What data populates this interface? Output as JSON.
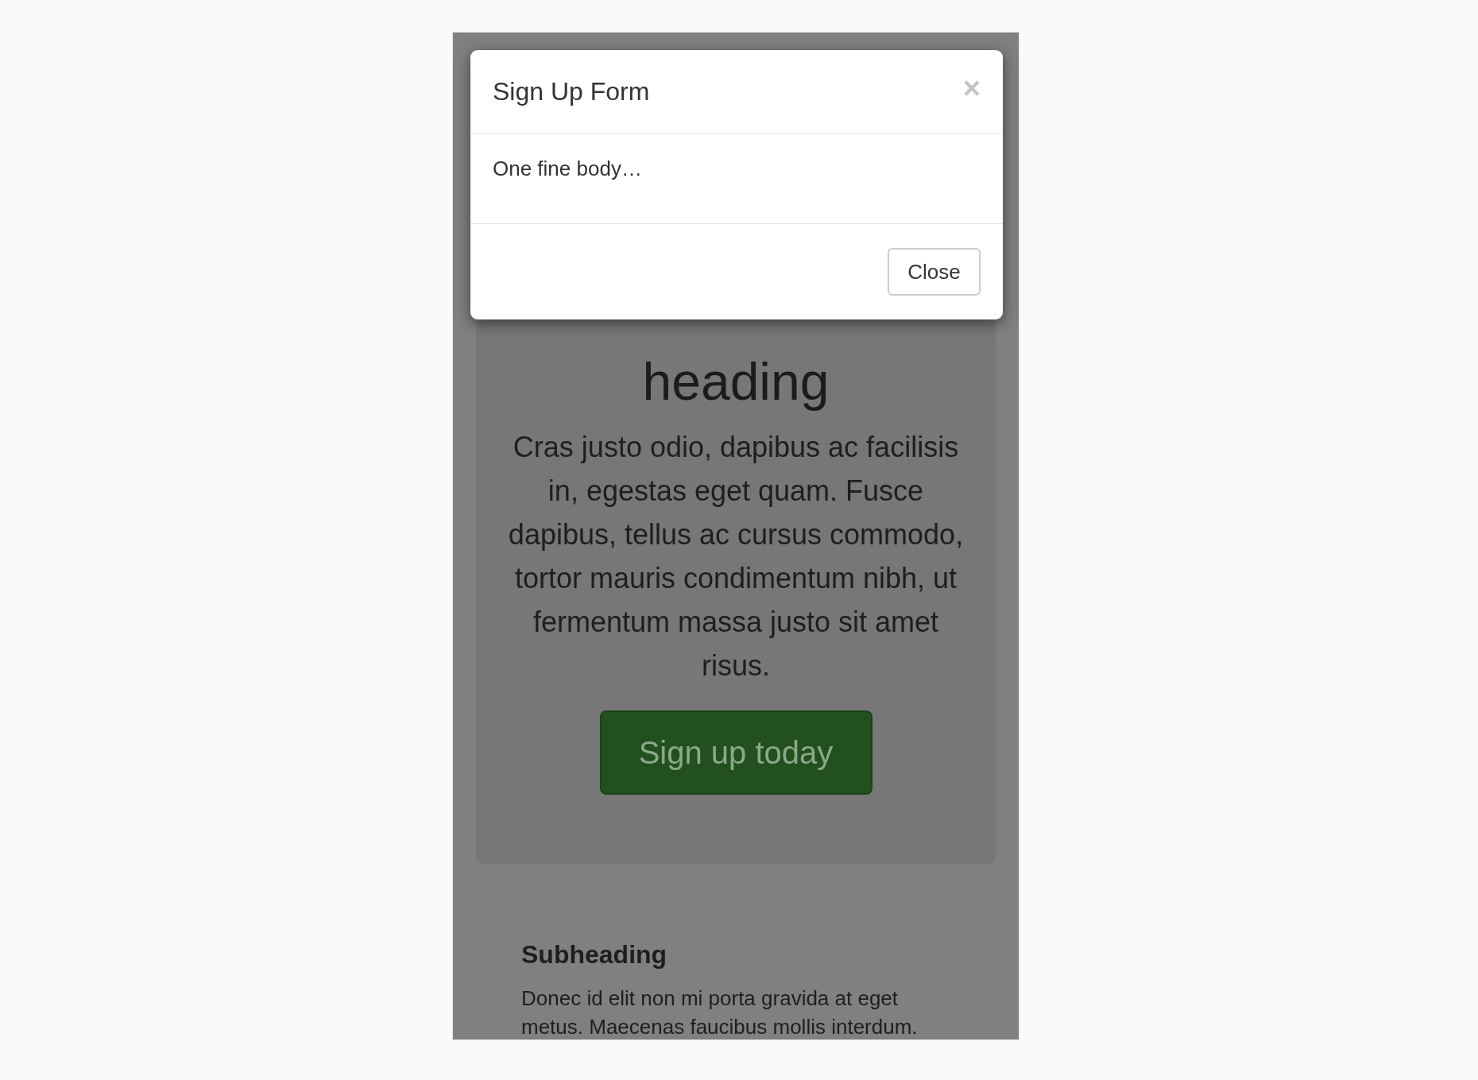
{
  "page": {
    "jumbotron": {
      "heading": "heading",
      "text": "Cras justo odio, dapibus ac facilisis in, egestas eget quam. Fusce dapibus, tellus ac cursus commodo, tortor mauris condimentum nibh, ut fermentum massa justo sit amet risus.",
      "button": "Sign up today"
    },
    "section": {
      "subheading": "Subheading",
      "text": "Donec id elit non mi porta gravida at eget metus. Maecenas faucibus mollis interdum."
    }
  },
  "modal": {
    "open": true,
    "title": "Sign Up Form",
    "close_icon": "×",
    "body": "One fine body…",
    "buttons": [
      "Close"
    ]
  }
}
